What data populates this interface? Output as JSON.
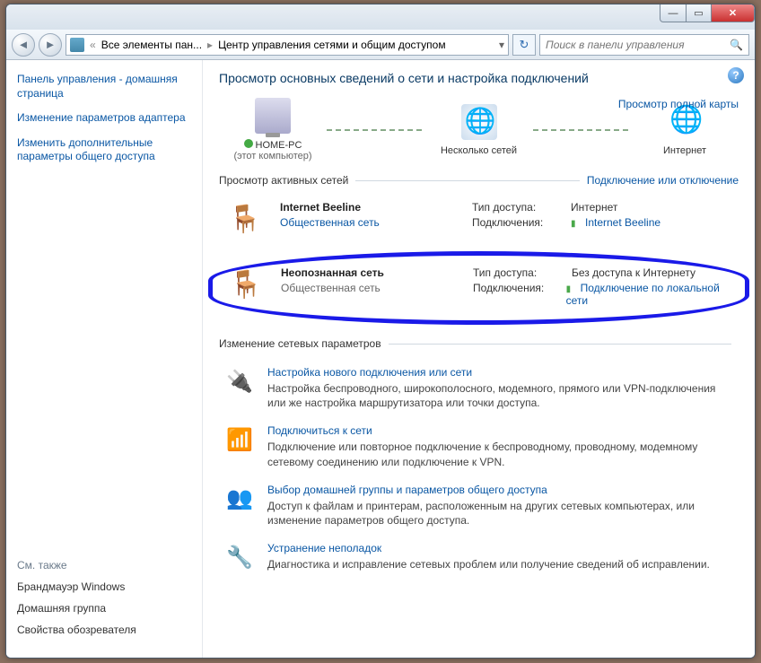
{
  "titlebar": {
    "min": "—",
    "max": "▭",
    "close": "✕"
  },
  "nav": {
    "back": "◄",
    "fwd": "►",
    "crumb_pre": "«",
    "crumb1": "Все элементы пан...",
    "crumb2": "Центр управления сетями и общим доступом",
    "drop": "▾",
    "refresh": "↻",
    "search_ph": "Поиск в панели управления",
    "search_icon": "🔍"
  },
  "sidebar": {
    "link1": "Панель управления - домашняя страница",
    "link2": "Изменение параметров адаптера",
    "link3": "Изменить дополнительные параметры общего доступа",
    "seealso": "См. также",
    "f1": "Брандмауэр Windows",
    "f2": "Домашняя группа",
    "f3": "Свойства обозревателя"
  },
  "main": {
    "help": "?",
    "title": "Просмотр основных сведений о сети и настройка подключений",
    "fullmap": "Просмотр полной карты",
    "map": {
      "pc_name": "HOME-PC",
      "pc_sub": "(этот компьютер)",
      "mid": "Несколько сетей",
      "net": "Интернет"
    },
    "active_hdr": "Просмотр активных сетей",
    "active_rlink": "Подключение или отключение",
    "net1": {
      "name": "Internet Beeline",
      "type": "Общественная сеть",
      "access_l": "Тип доступа:",
      "access_v": "Интернет",
      "conn_l": "Подключения:",
      "conn_v": "Internet Beeline"
    },
    "net2": {
      "name": "Неопознанная сеть",
      "type": "Общественная сеть",
      "access_l": "Тип доступа:",
      "access_v": "Без доступа к Интернету",
      "conn_l": "Подключения:",
      "conn_v": "Подключение по локальной сети"
    },
    "change_hdr": "Изменение сетевых параметров",
    "t1": {
      "title": "Настройка нового подключения или сети",
      "desc": "Настройка беспроводного, широкополосного, модемного, прямого или VPN-подключения или же настройка маршрутизатора или точки доступа."
    },
    "t2": {
      "title": "Подключиться к сети",
      "desc": "Подключение или повторное подключение к беспроводному, проводному, модемному сетевому соединению или подключение к VPN."
    },
    "t3": {
      "title": "Выбор домашней группы и параметров общего доступа",
      "desc": "Доступ к файлам и принтерам, расположенным на других сетевых компьютерах, или изменение параметров общего доступа."
    },
    "t4": {
      "title": "Устранение неполадок",
      "desc": "Диагностика и исправление сетевых проблем или получение сведений об исправлении."
    }
  }
}
